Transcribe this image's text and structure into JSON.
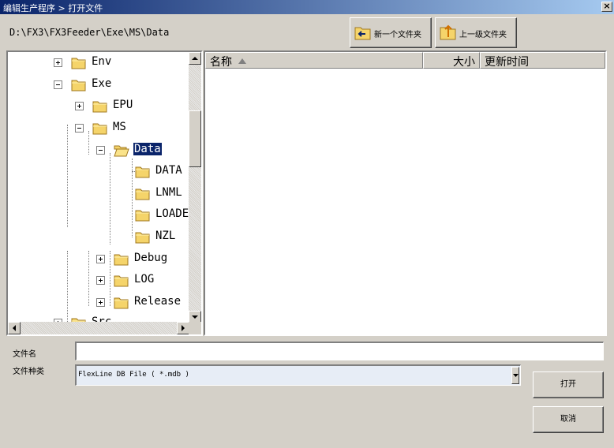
{
  "window": {
    "title": "编辑生产程序 > 打开文件",
    "close_glyph": "×"
  },
  "current_path": "D:\\FX3\\FX3Feeder\\Exe\\MS\\Data",
  "toolbar": {
    "new_folder_label": "新一个文件夹",
    "up_folder_label": "上一级文件夹"
  },
  "tree": {
    "items": [
      {
        "label": "Env",
        "expander": "plus"
      },
      {
        "label": "Exe",
        "expander": "minus"
      },
      {
        "label": "EPU",
        "expander": "plus"
      },
      {
        "label": "MS",
        "expander": "minus"
      },
      {
        "label": "Data",
        "expander": "minus",
        "selected": true
      },
      {
        "label": "DATA",
        "expander": "none"
      },
      {
        "label": "LNML",
        "expander": "none"
      },
      {
        "label": "LOADE",
        "expander": "none"
      },
      {
        "label": "NZL",
        "expander": "none"
      },
      {
        "label": "Debug",
        "expander": "plus"
      },
      {
        "label": "LOG",
        "expander": "plus"
      },
      {
        "label": "Release",
        "expander": "plus"
      },
      {
        "label": "Src",
        "expander": "plus"
      }
    ]
  },
  "file_list": {
    "columns": [
      {
        "label": "名称",
        "sorted": "ascending"
      },
      {
        "label": "大小"
      },
      {
        "label": "更新时间"
      }
    ],
    "rows": []
  },
  "form": {
    "filename_label": "文件名",
    "filename_value": "",
    "filetype_label": "文件种类",
    "filetype_value": "FlexLine DB File ( *.mdb )"
  },
  "buttons": {
    "open_label": "打开",
    "cancel_label": "取消"
  },
  "colors": {
    "selection": "#0a246a",
    "face": "#d4d0c8",
    "folder": "#f5d46a"
  }
}
